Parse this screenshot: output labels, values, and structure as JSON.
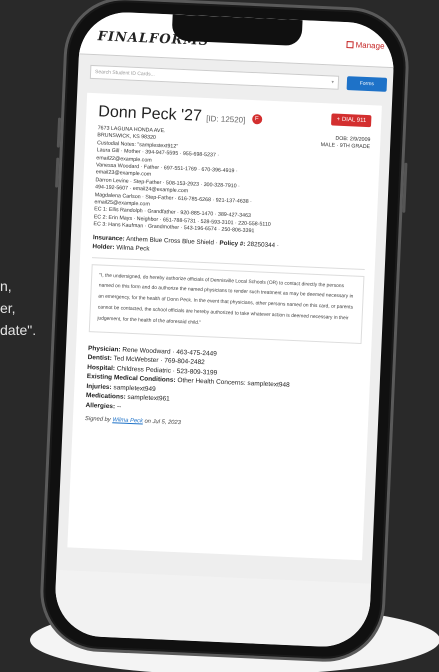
{
  "side_text": [
    "n,",
    "er,",
    "date\"."
  ],
  "app": {
    "logo": "FINALFORMS",
    "manage_label": "Manage"
  },
  "search": {
    "placeholder": "Search Student ID Cards...",
    "forms_label": "Forms"
  },
  "student": {
    "name": "Donn Peck '27",
    "id": "[ID: 12520]",
    "flag": "F",
    "dial_label": "+ DIAL 911",
    "address_line1": "7673 LAGUNA HONDA AVE.",
    "address_line2": "BRUNSWICK, KS 98320",
    "dob": "DOB: 2/9/2009",
    "sex_grade": "MALE · 9TH GRADE",
    "custodial_notes": "Custodial Notes: \"samplestext912\"",
    "contacts": [
      "Laura Gill · Mother · 394-947-5595 · 955-698-5237 ·",
      "email22@example.com",
      "Vanessa Woodard · Father · 697-551-1769 · 670-396-4919 ·",
      "email23@example.com",
      "Darron Levine · Step-Father · 508-153-2923 · 300-328-7910 ·",
      "494-192-5607 · email24@example.com",
      "Magdalena Carlson · Step-Father · 616-785-6268 · 921-137-4638 ·",
      "email25@example.com",
      "EC 1: Ellis Randolph · Grandfather · 920-885-1470 · 389-427-3463",
      "EC 2: Erin Mays · Neighbor · 651-788-5731 · 528-593-3101 · 220-558-5110",
      "EC 3: Hans Kaufman · Grandmother · 543-196-6574 · 250-806-3391"
    ],
    "insurance_label": "Insurance:",
    "insurance_value": "Anthem Blue Cross Blue Shield",
    "policy_label": "Policy #:",
    "policy_value": "28250344",
    "holder_label": "Holder:",
    "holder_value": "Wilma Peck"
  },
  "authorization": "\"I, the undersigned, do hereby authorize officials of Dennisville Local Schools (OR) to contact directly the persons named on this form and do authorize the named physicians to render such treatment as may be deemed necessary in an emergency, for the health of Donn Peck. In the event that physicians, other persons named on this card, or parents cannot be contacted, the school officials are hereby authorized to take whatever action is deemed necessary in their judgement, for the health of the aforesaid child.\"",
  "medical": {
    "physician_label": "Physician:",
    "physician_value": "Rene Woodward · 463-475-2449",
    "dentist_label": "Dentist:",
    "dentist_value": "Ted McWebster · 769-804-2482",
    "hospital_label": "Hospital:",
    "hospital_value": "Childress Pediatric · 523-809-3199",
    "conditions_label": "Existing Medical Conditions:",
    "conditions_value": "Other Health Concerns: sampletext948",
    "injuries_label": "Injuries:",
    "injuries_value": "sampletext949",
    "medications_label": "Medications:",
    "medications_value": "sampletext961",
    "allergies_label": "Allergies:",
    "allergies_value": "--"
  },
  "signature": {
    "prefix": "Signed by",
    "name": "Wilma Peck",
    "suffix": "on Jul 5, 2023"
  }
}
